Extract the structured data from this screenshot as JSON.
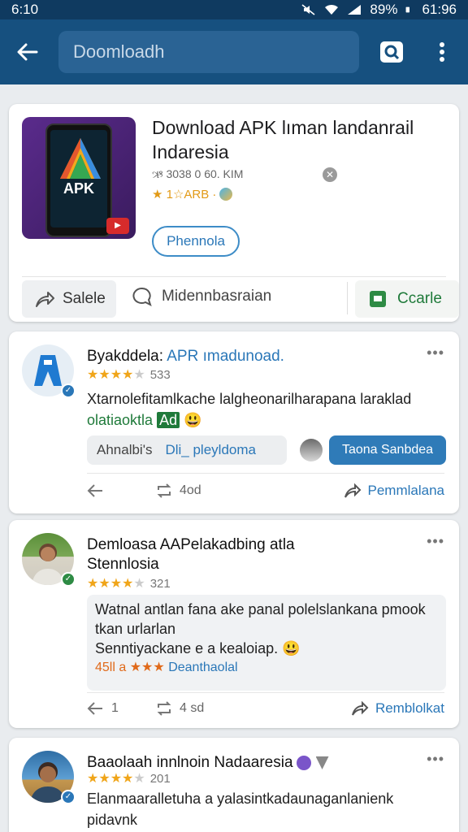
{
  "status_bar": {
    "time": "6:10",
    "battery": "89%",
    "clock": "61:96"
  },
  "app_bar": {
    "search_placeholder": "Doomloadh"
  },
  "hero": {
    "title": "Download APK lıman landanrail Indaresia",
    "meta": "ઋ 3038 0 60. KIM",
    "rating": "★ 1☆ARB ·",
    "primary_button": "Phennola",
    "share_label": "Salele",
    "comment_label": "Midennbasraian",
    "create_label": "Ccarle",
    "thumb_text": "APK"
  },
  "posts": [
    {
      "name": "Byakddela: ",
      "name_link": "APR ımadunoad.",
      "rating_count": "533",
      "body": "Xtarnolefitamlkache lalgheonarilharapana laraklad",
      "green_text": "olatiaoktla",
      "tag": "Ad",
      "chip_gray_1": "Ahnalbi's",
      "chip_gray_2": "Dli_ pleyldoma",
      "chip_blue": "Taona Sanbdea",
      "action_1": "",
      "action_2": "4od",
      "action_3": "Pemmlalana"
    },
    {
      "name": "Demloasa AAPelakadbing atla",
      "subname": "Stennlosia",
      "rating_count": "321",
      "quote_line_1": "Watnal antlan fana ake panal polelslankana pmook",
      "quote_line_2": "tkan urlarlan",
      "quote_line_3": "Senntiyackane e a kealoiap.",
      "quote_stats": "45ll a",
      "quote_stats_link": "Deanthaolal",
      "action_1": "1",
      "action_2": "4 sd",
      "action_3": "Remblolkat"
    },
    {
      "name": "Baaolaah innlnoin Nadaaresia",
      "rating_count": "201",
      "body": "Elanmaaralletuha a yalasintkadaunaganlanienk pidavnk"
    }
  ]
}
